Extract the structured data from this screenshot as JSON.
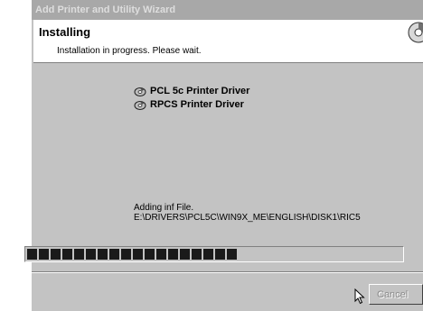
{
  "window": {
    "title": "Add Printer and Utility Wizard"
  },
  "header": {
    "title": "Installing",
    "subtitle": "Installation in progress. Please wait."
  },
  "drivers": [
    {
      "label": "PCL 5c Printer Driver",
      "icon": "disc-icon"
    },
    {
      "label": "RPCS Printer Driver",
      "icon": "disc-icon"
    }
  ],
  "status": {
    "line1": "Adding inf File.",
    "line2": "E:\\DRIVERS\\PCL5C\\WIN9X_ME\\ENGLISH\\DISK1\\RIC5"
  },
  "progress": {
    "value": 0.58,
    "color": "#1a1a1a"
  },
  "buttons": {
    "cancel": "Cancel"
  },
  "colors": {
    "dialog_bg": "#c3c3c3",
    "titlebar_bg": "#a8a8a8",
    "header_bg": "#ffffff"
  }
}
